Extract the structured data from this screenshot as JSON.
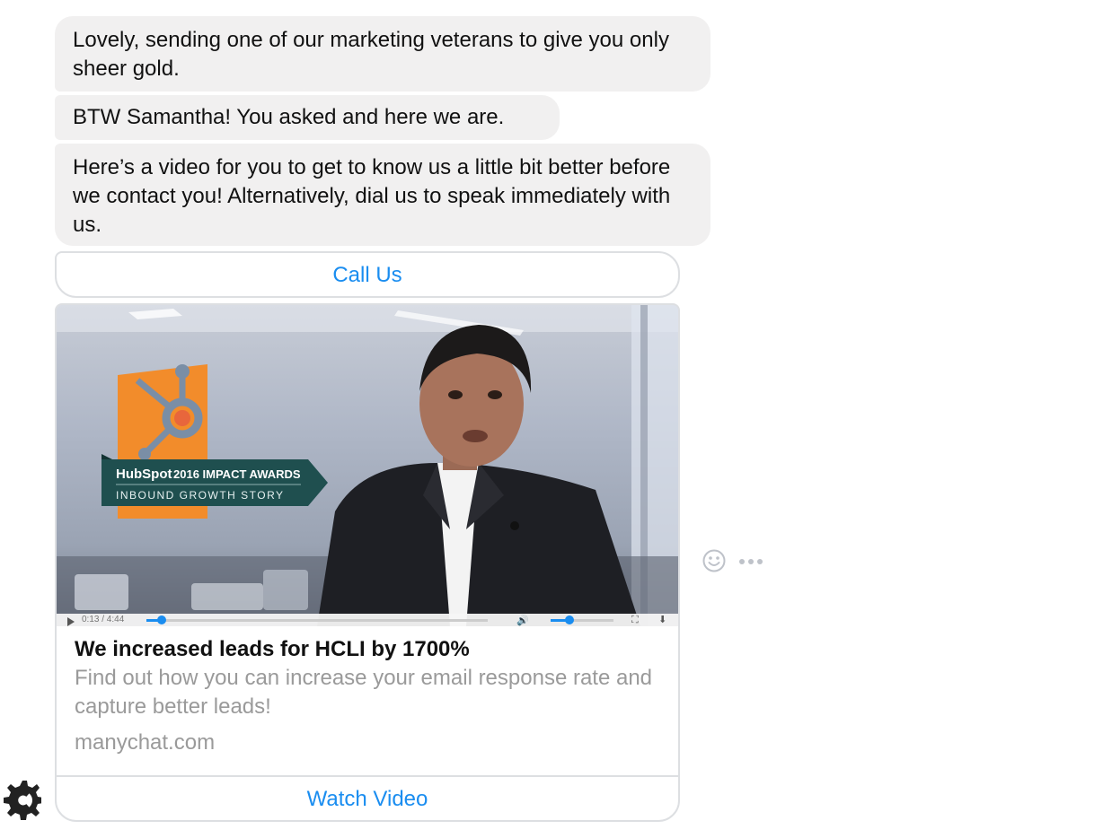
{
  "messages": [
    {
      "text": "Lovely, sending one of our marketing veterans to give you only sheer gold."
    },
    {
      "text": "BTW Samantha! You asked and here we are."
    },
    {
      "text": "Here’s a video for you to get to know us a little bit better before we contact you! Alternatively, dial us to speak immediately with us."
    }
  ],
  "call_button": {
    "label": "Call Us"
  },
  "video_card": {
    "overlay": {
      "brand": "HubSpot",
      "award": "2016 IMPACT AWARDS",
      "story": "INBOUND GROWTH STORY"
    },
    "player": {
      "time": "0:13 / 4:44",
      "progress": 0.05,
      "volume": 0.3
    },
    "title": "We increased leads for HCLI by 1700%",
    "subtitle": "Find out how you can increase your email response rate and capture better leads!",
    "domain": "manychat.com",
    "button_label": "Watch Video"
  },
  "colors": {
    "accent": "#1a8df0",
    "bubble": "#f1f0f0",
    "border": "#dddfe2",
    "muted_text": "#9a9a9a",
    "award_banner": "#1f4f4f",
    "hubspot_orange": "#f28c2b"
  },
  "icons": {
    "reaction": "smiley-icon",
    "more": "ellipsis-icon",
    "avatar": "manychat-gear-icon"
  }
}
